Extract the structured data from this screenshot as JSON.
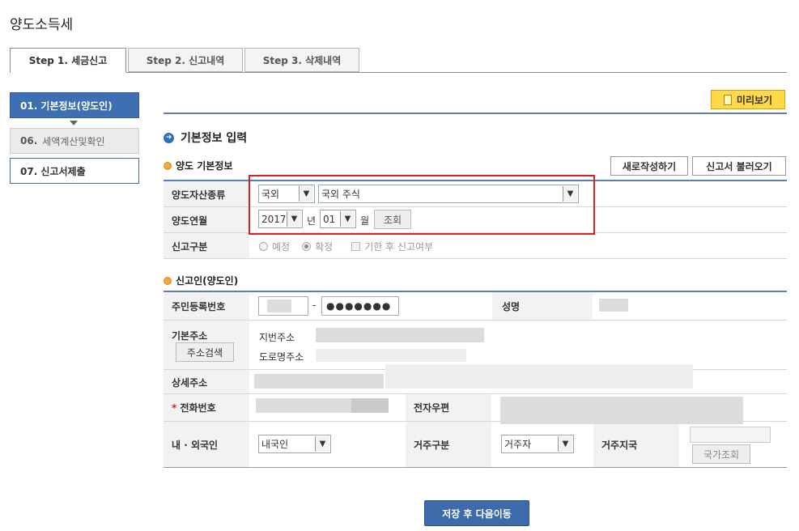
{
  "page": {
    "title": "양도소득세"
  },
  "tabs": [
    {
      "label": "Step 1. 세금신고"
    },
    {
      "label": "Step 2. 신고내역"
    },
    {
      "label": "Step 3. 삭제내역"
    }
  ],
  "sidebar": {
    "items": [
      {
        "label": "01. 기본정보(양도인)"
      },
      {
        "num": "06.",
        "label": "세액계산및확인"
      },
      {
        "label": "07. 신고서제출"
      }
    ]
  },
  "preview": {
    "label": "미리보기"
  },
  "section": {
    "title": "기본정보 입력"
  },
  "transfer": {
    "title": "양도 기본정보",
    "new_label": "새로작성하기",
    "load_label": "신고서 불러오기",
    "asset_type_label": "양도자산종류",
    "asset_region": "국외",
    "asset_kind": "국외 주식",
    "transfer_date_label": "양도연월",
    "year": "2017",
    "year_unit": "년",
    "month": "01",
    "month_unit": "월",
    "lookup_label": "조회",
    "report_type_label": "신고구분",
    "opt_expected": "예정",
    "opt_confirmed": "확정",
    "opt_late": "기한 후 신고여부"
  },
  "reporter": {
    "title": "신고인(양도인)",
    "rrn_label": "주민등록번호",
    "rrn_dash": "-",
    "rrn_masked": "●●●●●●●",
    "name_label": "성명",
    "address_label": "기본주소",
    "address_search": "주소검색",
    "lot_address": "지번주소",
    "road_address": "도로명주소",
    "detail_label": "상세주소",
    "phone_label": "전화번호",
    "phone_required": "*",
    "email_label": "전자우편",
    "nationality_label": "내 · 외국인",
    "nationality_value": "내국인",
    "residence_label": "거주구분",
    "residence_value": "거주자",
    "country_label": "거주지국",
    "country_lookup": "국가조회"
  },
  "footer": {
    "save_label": "저장 후 다음이동"
  }
}
